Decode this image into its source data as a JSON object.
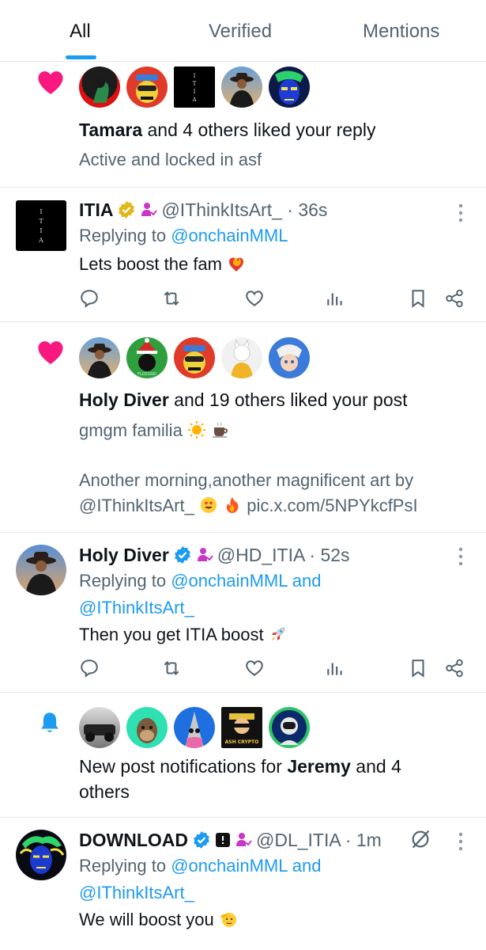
{
  "tabs": [
    {
      "label": "All",
      "active": true
    },
    {
      "label": "Verified",
      "active": false
    },
    {
      "label": "Mentions",
      "active": false
    }
  ],
  "notif1": {
    "icon": "heart-icon",
    "name": "Tamara",
    "text": " and 4 others liked your reply",
    "sub": "Active and locked in asf"
  },
  "tweet1": {
    "name": "ITIA",
    "handle": "@IThinkItsArt_ · 36s",
    "replying_prefix": "Replying to ",
    "replying_to": "@onchainMML",
    "body": "Lets boost the fam",
    "avatar_text": "I T I A"
  },
  "notif2": {
    "icon": "heart-icon",
    "name": "Holy Diver",
    "text": " and 19 others liked your post",
    "line1": "gmgm familia",
    "line2": "Another morning,another magnificent art by",
    "line3a": "@IThinkItsArt_",
    "line3b": "pic.x.com/5NPYkcfPsI"
  },
  "tweet2": {
    "name": "Holy Diver",
    "handle": "@HD_ITIA · 52s",
    "replying_prefix": "Replying to ",
    "replying_to": "@onchainMML and",
    "replying_to2": "@IThinkItsArt_",
    "body": "Then you get ITIA boost"
  },
  "notif3": {
    "icon": "bell-icon",
    "text_prefix": "New post notifications for ",
    "name": "Jeremy",
    "text_suffix": " and 4",
    "text_line2": "others",
    "avatar_label": "ASH CRYPTO"
  },
  "tweet3": {
    "name": "DOWNLOAD",
    "handle": "@DL_ITIA · 1m",
    "replying_prefix": "Replying to ",
    "replying_to": "@onchainMML and",
    "replying_to2": "@IThinkItsArt_",
    "body": "We will boost you"
  },
  "colors": {
    "accent": "#1d9bf0",
    "heart": "#f91880",
    "secondary_text": "#536471",
    "verified_gold": "#e2b719",
    "verified_blue": "#1d9bf0",
    "affiliate_pink": "#c936c8"
  }
}
